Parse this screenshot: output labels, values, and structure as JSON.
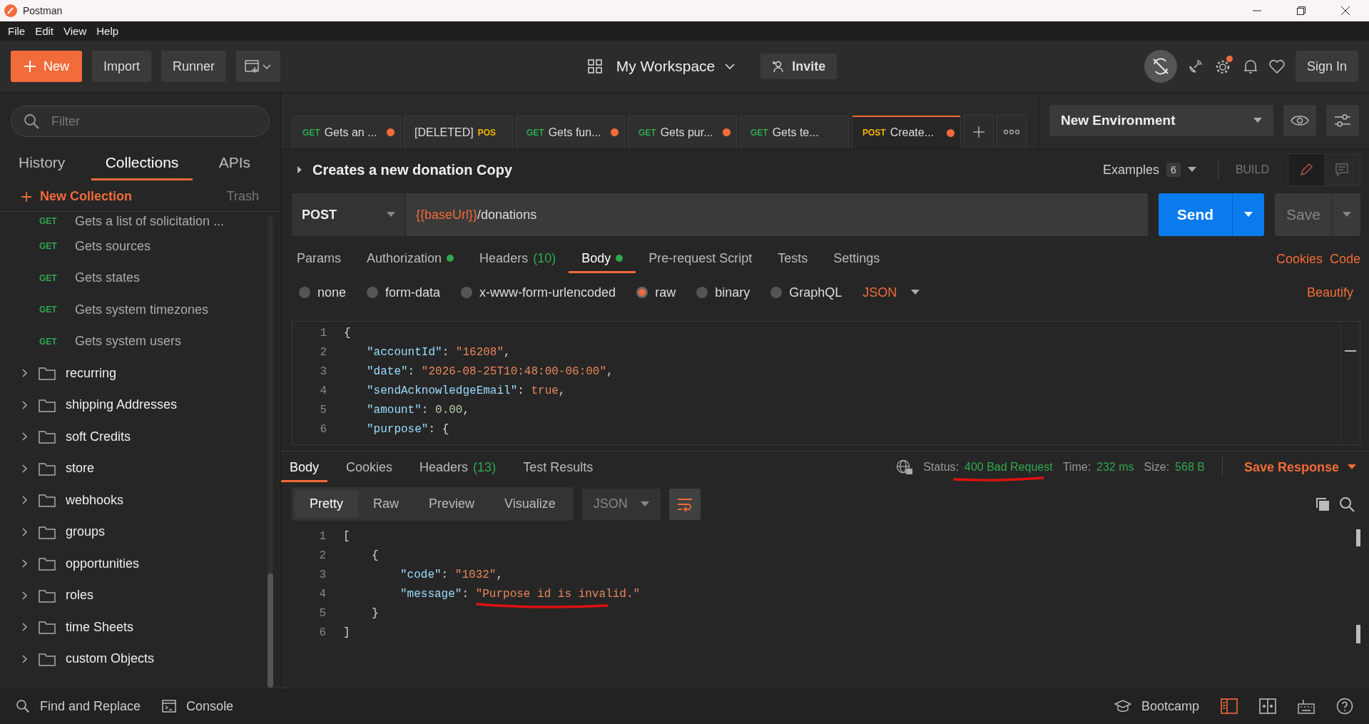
{
  "window": {
    "title": "Postman"
  },
  "menu": [
    "File",
    "Edit",
    "View",
    "Help"
  ],
  "toolbar": {
    "new": "New",
    "import": "Import",
    "runner": "Runner",
    "workspace": "My Workspace",
    "invite": "Invite",
    "sign_in": "Sign In",
    "settings_badge": true
  },
  "sidebar": {
    "filter_placeholder": "Filter",
    "tabs": [
      {
        "label": "History",
        "selected": false
      },
      {
        "label": "Collections",
        "selected": true
      },
      {
        "label": "APIs",
        "selected": false
      }
    ],
    "new_collection": "New Collection",
    "trash": "Trash",
    "items": [
      {
        "kind": "request",
        "method": "GET",
        "name": "Gets a list of solicitation ..."
      },
      {
        "kind": "request",
        "method": "GET",
        "name": "Gets sources"
      },
      {
        "kind": "request",
        "method": "GET",
        "name": "Gets states"
      },
      {
        "kind": "request",
        "method": "GET",
        "name": "Gets system timezones"
      },
      {
        "kind": "request",
        "method": "GET",
        "name": "Gets system users"
      },
      {
        "kind": "folder",
        "name": "recurring",
        "expanded": false
      },
      {
        "kind": "folder",
        "name": "shipping Addresses",
        "expanded": false
      },
      {
        "kind": "folder",
        "name": "soft Credits",
        "expanded": false
      },
      {
        "kind": "folder",
        "name": "store",
        "expanded": false
      },
      {
        "kind": "folder",
        "name": "webhooks",
        "expanded": false
      },
      {
        "kind": "folder",
        "name": "groups",
        "expanded": false
      },
      {
        "kind": "folder",
        "name": "opportunities",
        "expanded": false
      },
      {
        "kind": "folder",
        "name": "roles",
        "expanded": false
      },
      {
        "kind": "folder",
        "name": "time Sheets",
        "expanded": false
      },
      {
        "kind": "folder",
        "name": "custom Objects",
        "expanded": false
      }
    ]
  },
  "request_tabs": [
    {
      "kind": "normal",
      "method": "GET",
      "name": "Gets an ...",
      "unsaved": true,
      "selected": false
    },
    {
      "kind": "deleted",
      "method": "POS",
      "name": "[DELETED]",
      "unsaved": false,
      "selected": false
    },
    {
      "kind": "normal",
      "method": "GET",
      "name": "Gets fun...",
      "unsaved": true,
      "selected": false
    },
    {
      "kind": "normal",
      "method": "GET",
      "name": "Gets pur...",
      "unsaved": true,
      "selected": false
    },
    {
      "kind": "normal",
      "method": "GET",
      "name": "Gets te...",
      "unsaved": false,
      "selected": false
    },
    {
      "kind": "normal",
      "method": "POST",
      "name": "Create...",
      "unsaved": true,
      "selected": true
    }
  ],
  "environment": "New Environment",
  "request": {
    "title": "Creates a new donation Copy",
    "examples_label": "Examples",
    "examples_count": "6",
    "build": "BUILD",
    "method": "POST",
    "url_var": "{{baseUrl}}",
    "url_path": "/donations",
    "send": "Send",
    "save": "Save",
    "tabs": [
      {
        "label": "Params",
        "selected": false,
        "dot": false
      },
      {
        "label": "Authorization",
        "selected": false,
        "dot": true
      },
      {
        "label": "Headers",
        "count": "(10)",
        "selected": false,
        "dot": false
      },
      {
        "label": "Body",
        "selected": true,
        "dot": true
      },
      {
        "label": "Pre-request Script",
        "selected": false,
        "dot": false
      },
      {
        "label": "Tests",
        "selected": false,
        "dot": false
      },
      {
        "label": "Settings",
        "selected": false,
        "dot": false
      }
    ],
    "links": [
      "Cookies",
      "Code"
    ],
    "body_types": [
      {
        "label": "none",
        "selected": false
      },
      {
        "label": "form-data",
        "selected": false
      },
      {
        "label": "x-www-form-urlencoded",
        "selected": false
      },
      {
        "label": "raw",
        "selected": true
      },
      {
        "label": "binary",
        "selected": false
      },
      {
        "label": "GraphQL",
        "selected": false
      }
    ],
    "format": "JSON",
    "beautify": "Beautify",
    "code": [
      {
        "n": "1",
        "tokens": [
          {
            "kind": "punct",
            "text": "{"
          }
        ],
        "children": [
          {
            "n": "2",
            "tokens": [
              {
                "kind": "key",
                "text": "\"accountId\""
              },
              {
                "kind": "punct",
                "text": ":"
              },
              {
                "kind": "str",
                "text": "\"16208\""
              },
              {
                "kind": "punct",
                "text": ","
              }
            ]
          },
          {
            "n": "3",
            "tokens": [
              {
                "kind": "key",
                "text": "\"date\""
              },
              {
                "kind": "punct",
                "text": ":"
              },
              {
                "kind": "str",
                "text": "\"2026-08-25T10:48:00-06:00\""
              },
              {
                "kind": "punct",
                "text": ","
              }
            ]
          },
          {
            "n": "4",
            "tokens": [
              {
                "kind": "key",
                "text": "\"sendAcknowledgeEmail\""
              },
              {
                "kind": "punct",
                "text": ":"
              },
              {
                "kind": "bool",
                "text": "true"
              },
              {
                "kind": "punct",
                "text": ","
              }
            ]
          },
          {
            "n": "5",
            "tokens": [
              {
                "kind": "key",
                "text": "\"amount\""
              },
              {
                "kind": "punct",
                "text": ":"
              },
              {
                "kind": "num",
                "text": "0.00"
              },
              {
                "kind": "punct",
                "text": ","
              }
            ]
          },
          {
            "n": "6",
            "tokens": [
              {
                "kind": "key",
                "text": "\"purpose\""
              },
              {
                "kind": "punct",
                "text": ":"
              },
              {
                "kind": "punct",
                "text": "{"
              }
            ]
          }
        ]
      }
    ]
  },
  "response": {
    "tabs": [
      {
        "label": "Body",
        "selected": true
      },
      {
        "label": "Cookies",
        "selected": false
      },
      {
        "label": "Headers",
        "count": "(13)",
        "selected": false
      },
      {
        "label": "Test Results",
        "selected": false
      }
    ],
    "status_label": "Status:",
    "status": "400 Bad Request",
    "status_underlined": true,
    "time_label": "Time:",
    "time": "232 ms",
    "size_label": "Size:",
    "size": "568 B",
    "save_response": "Save Response",
    "views": [
      {
        "label": "Pretty",
        "selected": true
      },
      {
        "label": "Raw",
        "selected": false
      },
      {
        "label": "Preview",
        "selected": false
      },
      {
        "label": "Visualize",
        "selected": false
      }
    ],
    "format": "JSON",
    "wrap": true,
    "code": [
      {
        "n": "1",
        "tokens": [
          {
            "kind": "punct",
            "text": "["
          }
        ],
        "children": [
          {
            "n": "2",
            "tokens": [
              {
                "kind": "punct",
                "text": "{"
              }
            ],
            "children": [
              {
                "n": "3",
                "tokens": [
                  {
                    "kind": "key",
                    "text": "\"code\""
                  },
                  {
                    "kind": "punct",
                    "text": ":"
                  },
                  {
                    "kind": "str",
                    "text": "\"1032\""
                  },
                  {
                    "kind": "punct",
                    "text": ","
                  }
                ]
              },
              {
                "n": "4",
                "tokens": [
                  {
                    "kind": "key",
                    "text": "\"message\""
                  },
                  {
                    "kind": "punct",
                    "text": ":"
                  },
                  {
                    "kind": "str",
                    "text": "\"Purpose id is invalid.\"",
                    "underlined": true
                  }
                ]
              }
            ]
          },
          {
            "n": "5",
            "tokens": [
              {
                "kind": "punct",
                "text": "}"
              }
            ]
          }
        ]
      },
      {
        "n": "6",
        "tokens": [
          {
            "kind": "punct",
            "text": "]"
          }
        ]
      }
    ]
  },
  "status_bar": {
    "find": "Find and Replace",
    "console": "Console",
    "bootcamp": "Bootcamp"
  }
}
